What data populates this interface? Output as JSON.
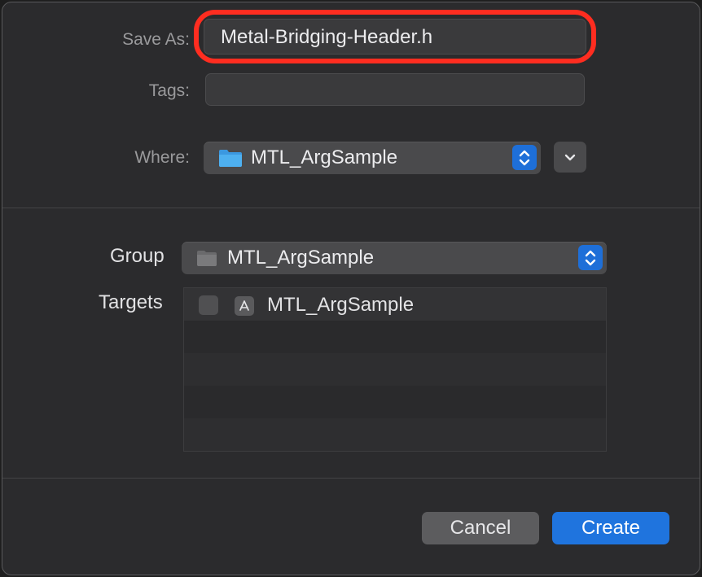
{
  "dialog": {
    "save_as": {
      "label": "Save As:",
      "value": "Metal-Bridging-Header.h"
    },
    "tags": {
      "label": "Tags:",
      "value": ""
    },
    "where": {
      "label": "Where:",
      "value": "MTL_ArgSample",
      "icon": "folder-icon"
    },
    "group": {
      "label": "Group",
      "value": "MTL_ArgSample",
      "icon": "folder-icon"
    },
    "targets": {
      "label": "Targets",
      "items": [
        {
          "label": "MTL_ArgSample",
          "checked": false,
          "icon": "app-target-icon"
        }
      ]
    },
    "buttons": {
      "cancel": "Cancel",
      "create": "Create"
    }
  },
  "colors": {
    "accent": "#1f74de",
    "highlight": "#ff2d20",
    "folder": "#4aa8ea"
  }
}
